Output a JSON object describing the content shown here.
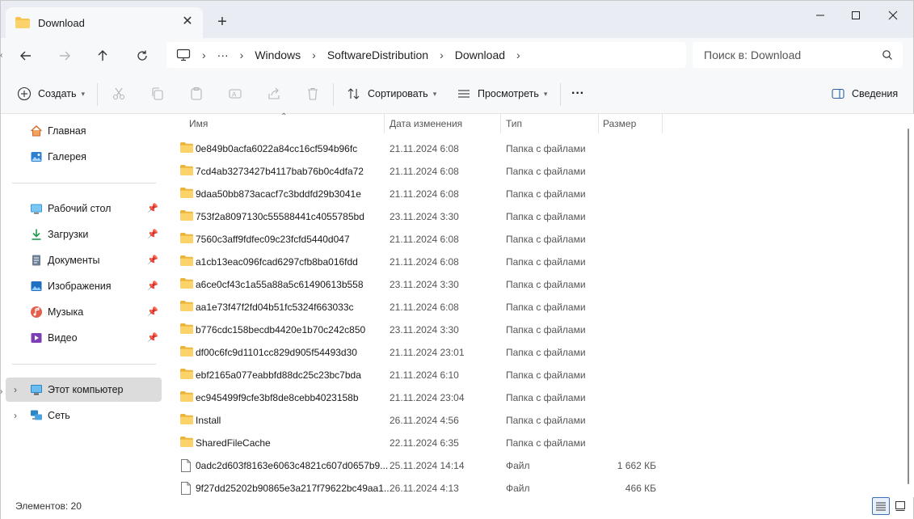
{
  "tab": {
    "title": "Download",
    "icon": "folder-icon"
  },
  "window_controls": {
    "minimize": "minimize-icon",
    "maximize": "maximize-icon",
    "close": "close-icon"
  },
  "breadcrumb": {
    "more": "···",
    "segments": [
      "Windows",
      "SoftwareDistribution",
      "Download"
    ]
  },
  "search": {
    "placeholder": "Поиск в: Download"
  },
  "toolbar": {
    "create_label": "Создать",
    "sort_label": "Сортировать",
    "view_label": "Просмотреть",
    "more_label": "···",
    "details_label": "Сведения"
  },
  "sidebar": {
    "home": "Главная",
    "gallery": "Галерея",
    "quick": [
      {
        "label": "Рабочий стол",
        "icon": "desktop-icon"
      },
      {
        "label": "Загрузки",
        "icon": "downloads-icon"
      },
      {
        "label": "Документы",
        "icon": "documents-icon"
      },
      {
        "label": "Изображения",
        "icon": "pictures-icon"
      },
      {
        "label": "Музыка",
        "icon": "music-icon"
      },
      {
        "label": "Видео",
        "icon": "videos-icon"
      }
    ],
    "this_pc": "Этот компьютер",
    "network": "Сеть"
  },
  "columns": {
    "name": "Имя",
    "date": "Дата изменения",
    "type": "Тип",
    "size": "Размер"
  },
  "files": [
    {
      "name": "0e849b0acfa6022a84cc16cf594b96fc",
      "date": "21.11.2024 6:08",
      "type": "Папка с файлами",
      "size": ""
    },
    {
      "name": "7cd4ab3273427b4117bab76b0c4dfa72",
      "date": "21.11.2024 6:08",
      "type": "Папка с файлами",
      "size": ""
    },
    {
      "name": "9daa50bb873acacf7c3bddfd29b3041e",
      "date": "21.11.2024 6:08",
      "type": "Папка с файлами",
      "size": ""
    },
    {
      "name": "753f2a8097130c55588441c4055785bd",
      "date": "23.11.2024 3:30",
      "type": "Папка с файлами",
      "size": ""
    },
    {
      "name": "7560c3aff9fdfec09c23fcfd5440d047",
      "date": "21.11.2024 6:08",
      "type": "Папка с файлами",
      "size": ""
    },
    {
      "name": "a1cb13eac096fcad6297cfb8ba016fdd",
      "date": "21.11.2024 6:08",
      "type": "Папка с файлами",
      "size": ""
    },
    {
      "name": "a6ce0cf43c1a55a88a5c61490613b558",
      "date": "23.11.2024 3:30",
      "type": "Папка с файлами",
      "size": ""
    },
    {
      "name": "aa1e73f47f2fd04b51fc5324f663033c",
      "date": "21.11.2024 6:08",
      "type": "Папка с файлами",
      "size": ""
    },
    {
      "name": "b776cdc158becdb4420e1b70c242c850",
      "date": "23.11.2024 3:30",
      "type": "Папка с файлами",
      "size": ""
    },
    {
      "name": "df00c6fc9d1101cc829d905f54493d30",
      "date": "21.11.2024 23:01",
      "type": "Папка с файлами",
      "size": ""
    },
    {
      "name": "ebf2165a077eabbfd88dc25c23bc7bda",
      "date": "21.11.2024 6:10",
      "type": "Папка с файлами",
      "size": ""
    },
    {
      "name": "ec945499f9cfe3bf8de8cebb4023158b",
      "date": "21.11.2024 23:04",
      "type": "Папка с файлами",
      "size": ""
    },
    {
      "name": "Install",
      "date": "26.11.2024 4:56",
      "type": "Папка с файлами",
      "size": ""
    },
    {
      "name": "SharedFileCache",
      "date": "22.11.2024 6:35",
      "type": "Папка с файлами",
      "size": ""
    },
    {
      "name": "0adc2d603f8163e6063c4821c607d0657b9...",
      "date": "25.11.2024 14:14",
      "type": "Файл",
      "size": "1 662 КБ"
    },
    {
      "name": "9f27dd25202b90865e3a217f79622bc49aa1...",
      "date": "26.11.2024 4:13",
      "type": "Файл",
      "size": "466 КБ"
    }
  ],
  "status": {
    "count": "Элементов: 20"
  }
}
